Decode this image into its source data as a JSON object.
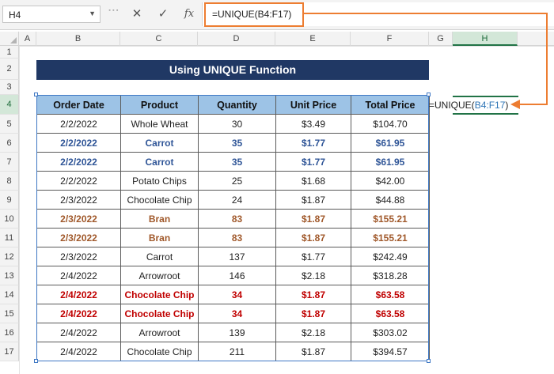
{
  "formula_bar": {
    "name_box": "H4",
    "formula": "=UNIQUE(B4:F17)",
    "cancel_icon": "close-icon",
    "enter_icon": "check-icon",
    "function_icon": "fx-icon"
  },
  "columns": [
    "A",
    "B",
    "C",
    "D",
    "E",
    "F",
    "G",
    "H"
  ],
  "rows": [
    "1",
    "2",
    "3",
    "4",
    "5",
    "6",
    "7",
    "8",
    "9",
    "10",
    "11",
    "12",
    "13",
    "14",
    "15",
    "16",
    "17"
  ],
  "selected_column": "H",
  "selected_row": "4",
  "title": "Using UNIQUE Function",
  "table": {
    "headers": [
      "Order Date",
      "Product",
      "Quantity",
      "Unit Price",
      "Total Price"
    ],
    "rows": [
      {
        "cells": [
          "2/2/2022",
          "Whole Wheat",
          "30",
          "$3.49",
          "$104.70"
        ],
        "highlight": "none"
      },
      {
        "cells": [
          "2/2/2022",
          "Carrot",
          "35",
          "$1.77",
          "$61.95"
        ],
        "highlight": "blue"
      },
      {
        "cells": [
          "2/2/2022",
          "Carrot",
          "35",
          "$1.77",
          "$61.95"
        ],
        "highlight": "blue"
      },
      {
        "cells": [
          "2/2/2022",
          "Potato Chips",
          "25",
          "$1.68",
          "$42.00"
        ],
        "highlight": "none"
      },
      {
        "cells": [
          "2/3/2022",
          "Chocolate Chip",
          "24",
          "$1.87",
          "$44.88"
        ],
        "highlight": "none"
      },
      {
        "cells": [
          "2/3/2022",
          "Bran",
          "83",
          "$1.87",
          "$155.21"
        ],
        "highlight": "brown"
      },
      {
        "cells": [
          "2/3/2022",
          "Bran",
          "83",
          "$1.87",
          "$155.21"
        ],
        "highlight": "brown"
      },
      {
        "cells": [
          "2/3/2022",
          "Carrot",
          "137",
          "$1.77",
          "$242.49"
        ],
        "highlight": "none"
      },
      {
        "cells": [
          "2/4/2022",
          "Arrowroot",
          "146",
          "$2.18",
          "$318.28"
        ],
        "highlight": "none"
      },
      {
        "cells": [
          "2/4/2022",
          "Chocolate Chip",
          "34",
          "$1.87",
          "$63.58"
        ],
        "highlight": "red"
      },
      {
        "cells": [
          "2/4/2022",
          "Chocolate Chip",
          "34",
          "$1.87",
          "$63.58"
        ],
        "highlight": "red"
      },
      {
        "cells": [
          "2/4/2022",
          "Arrowroot",
          "139",
          "$2.18",
          "$303.02"
        ],
        "highlight": "none"
      },
      {
        "cells": [
          "2/4/2022",
          "Chocolate Chip",
          "211",
          "$1.87",
          "$394.57"
        ],
        "highlight": "none"
      }
    ]
  },
  "cell_h4": {
    "prefix": "=UNIQUE(",
    "range": "B4:F17",
    "suffix": ")"
  },
  "colors": {
    "title_bg": "#203864",
    "header_bg": "#9dc3e6",
    "dup_blue": "#2f5597",
    "dup_brown": "#a0582a",
    "dup_red": "#c00000",
    "callout": "#ed7d31",
    "excel_green": "#217346"
  }
}
